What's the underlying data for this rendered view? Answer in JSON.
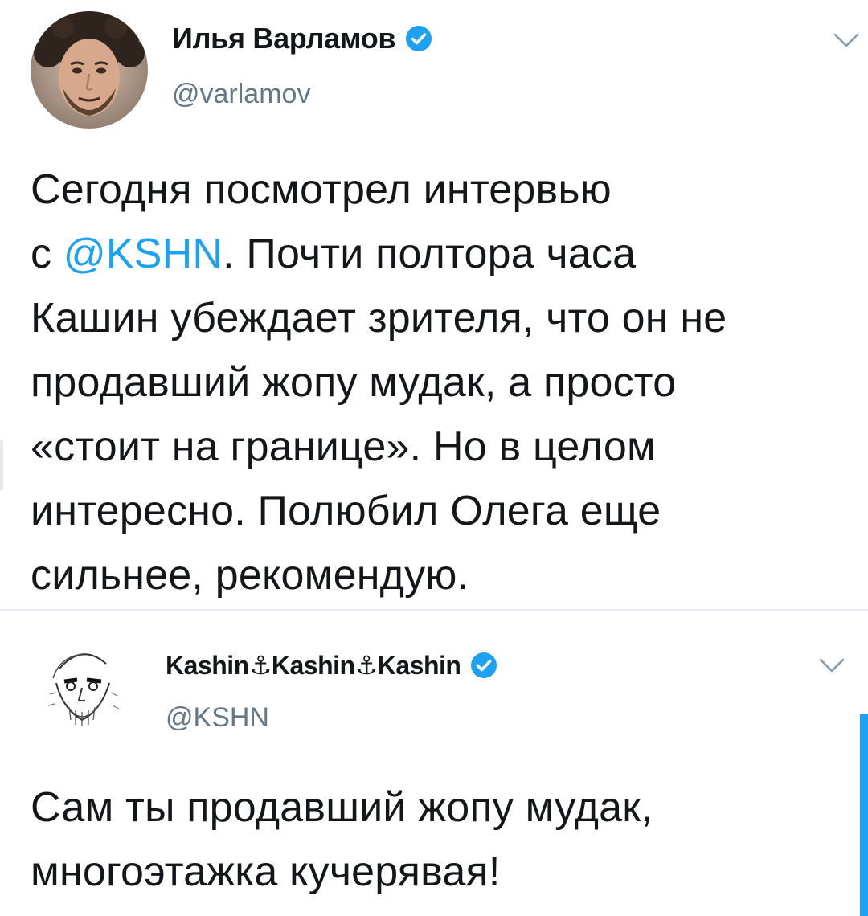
{
  "tweets": [
    {
      "author": {
        "name": "Илья Варламов",
        "handle": "@varlamov",
        "verified": true
      },
      "text": {
        "line1": "Сегодня посмотрел интервью",
        "line2_before": "с ",
        "line2_mention": "@KSHN",
        "line2_after": ". Почти полтора часа",
        "line3": "Кашин убеждает зрителя, что он не",
        "line4": "продавший жопу мудак, а просто",
        "line5": "«стоит на границе». Но в целом",
        "line6": "интересно. Полюбил Олега еще",
        "line7": "сильнее, рекомендую."
      }
    },
    {
      "author": {
        "name": "Kashin⚓Kashin⚓Kashin",
        "handle": "@KSHN",
        "verified": true
      },
      "text": {
        "line1": "Сам ты продавший жопу мудак,",
        "line2": "многоэтажка кучерявая!"
      }
    }
  ],
  "colors": {
    "text": "#14171a",
    "secondary": "#657786",
    "accent": "#1da1f2",
    "divider": "#e6ecf0"
  },
  "icons": {
    "verified": "verified-badge-icon",
    "caret": "chevron-down-icon"
  }
}
